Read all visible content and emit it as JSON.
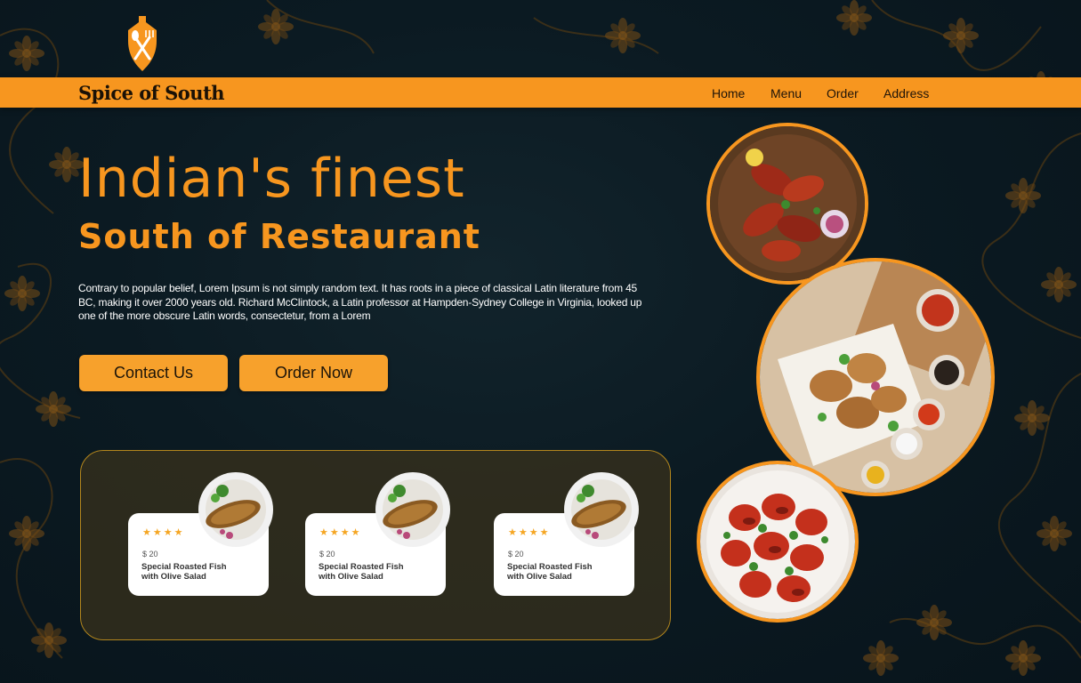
{
  "brand": {
    "name": "Spice of South"
  },
  "nav": {
    "items": [
      {
        "label": "Home"
      },
      {
        "label": "Menu"
      },
      {
        "label": "Order"
      },
      {
        "label": "Address"
      }
    ]
  },
  "hero": {
    "title": "Indian's finest",
    "subtitle": "South of Restaurant",
    "description": "Contrary to popular belief, Lorem Ipsum is not simply random text. It has roots in a piece of classical Latin literature from 45 BC, making it over 2000 years old. Richard McClintock, a Latin professor at Hampden-Sydney College in Virginia, looked up one of the more obscure Latin words, consectetur, from a Lorem",
    "contact_button": "Contact Us",
    "order_button": "Order Now"
  },
  "dishes": [
    {
      "rating": "★★★★",
      "price": "$ 20",
      "name_line1": "Special Roasted Fish",
      "name_line2": "with Olive Salad"
    },
    {
      "rating": "★★★★",
      "price": "$ 20",
      "name_line1": "Special Roasted Fish",
      "name_line2": "with Olive Salad"
    },
    {
      "rating": "★★★★",
      "price": "$ 20",
      "name_line1": "Special Roasted Fish",
      "name_line2": "with Olive Salad"
    }
  ],
  "colors": {
    "accent": "#f7961f",
    "background": "#0b1a22",
    "panel_border": "#b3861d"
  },
  "icons": {
    "logo": "chef-spoon-fork-logo-icon",
    "rating": "star-icon"
  }
}
